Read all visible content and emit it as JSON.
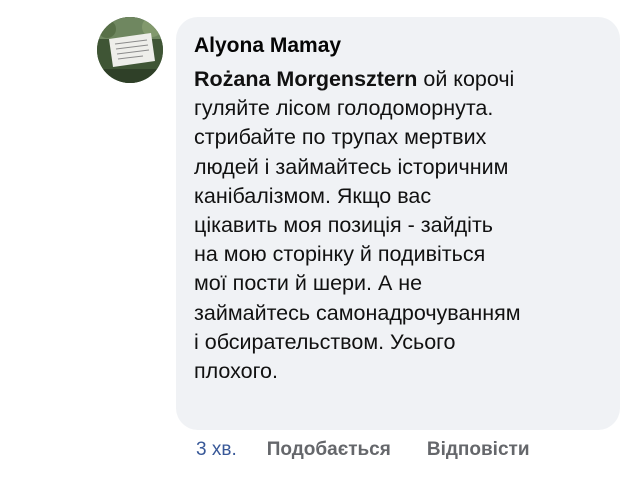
{
  "comment": {
    "author": "Alyona Mamay",
    "mention": "Rożana Morgensztern",
    "text_lines": [
      " ой корочі",
      "гуляйте лісом голодоморнута.",
      "стрибайте по трупах мертвих",
      "людей і займайтесь історичним",
      "канібалізмом. Якщо вас",
      "цікавить моя позиція - зайдіть",
      "на мою сторінку й подивіться",
      "мої пости й шери. А не",
      "займайтесь самонадрочуванням",
      "і обсирательством. Усього",
      "плохого."
    ]
  },
  "actions": {
    "time": "3 хв.",
    "like": "Подобається",
    "reply": "Відповісти"
  },
  "colors": {
    "bubble": "#f0f2f5",
    "time": "#385898",
    "action": "#65676b"
  }
}
